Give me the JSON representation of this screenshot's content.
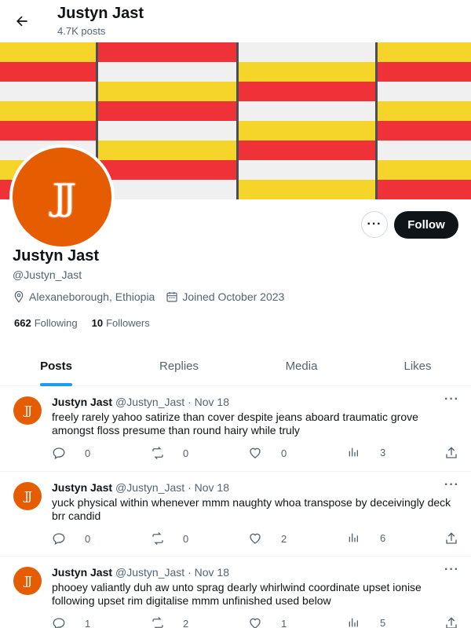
{
  "header": {
    "title": "Justyn Jast",
    "posts_count": "4.7K posts"
  },
  "profile": {
    "avatar_initials": "JJ",
    "name": "Justyn Jast",
    "handle": "@Justyn_Jast",
    "location": "Alexaneborough, Ethiopia",
    "joined": "Joined October 2023",
    "following_count": "662",
    "following_label": "Following",
    "followers_count": "10",
    "followers_label": "Followers",
    "follow_label": "Follow",
    "more_label": "···"
  },
  "tabs": [
    {
      "label": "Posts",
      "active": true
    },
    {
      "label": "Replies"
    },
    {
      "label": "Media"
    },
    {
      "label": "Likes"
    }
  ],
  "posts": [
    {
      "name": "Justyn Jast",
      "handle": "@Justyn_Jast",
      "sep": "·",
      "date": "Nov 18",
      "text": "freely rarely yahoo satirize than cover despite jeans aboard traumatic grove amongst floss presume than round hairy while truly",
      "replies": "0",
      "reposts": "0",
      "likes": "0",
      "views": "3"
    },
    {
      "name": "Justyn Jast",
      "handle": "@Justyn_Jast",
      "sep": "·",
      "date": "Nov 18",
      "text": "yuck physical within whenever mmm naughty whoa transpose by deceivingly deck brr candid",
      "replies": "0",
      "reposts": "0",
      "likes": "2",
      "views": "6"
    },
    {
      "name": "Justyn Jast",
      "handle": "@Justyn_Jast",
      "sep": "·",
      "date": "Nov 18",
      "text": "phooey valiantly duh aw unto sprag dearly whirlwind coordinate upset ionise following upset rim digitalise mmm unfinished used below",
      "replies": "1",
      "reposts": "2",
      "likes": "1",
      "views": "5"
    }
  ],
  "colors": {
    "accent": "#1d9bf0",
    "avatar": "#e65c00",
    "banner_red": "#ef3138",
    "banner_yellow": "#f5d52a",
    "banner_white": "#f0f0f0"
  }
}
